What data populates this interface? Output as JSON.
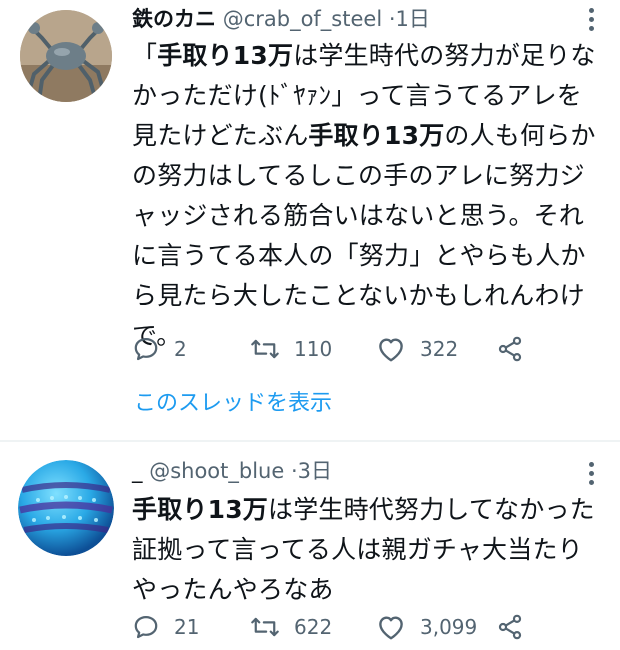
{
  "tweets": [
    {
      "display_name": "鉄のカニ",
      "handle": "@crab_of_steel",
      "separator": "·",
      "time": "1日",
      "body": [
        {
          "text": "「"
        },
        {
          "text": "手取り13万",
          "bold": true
        },
        {
          "text": "は学生時代の努力が足りなかっただけ(ﾄﾞﾔｧﾝ」って言うてるアレを見たけどたぶん"
        },
        {
          "text": "手取り13万",
          "bold": true
        },
        {
          "text": "の人も何らかの努力はしてるしこの手のアレに努力ジャッジされる筋合いはないと思う。それに言うてる本人の「努力」とやらも人から見たら大したことないかもしれんわけで。"
        }
      ],
      "replies": "2",
      "retweets": "110",
      "likes": "322",
      "thread_link": "このスレッドを表示"
    },
    {
      "display_name": "_",
      "handle": "@shoot_blue",
      "separator": "·",
      "time": "3日",
      "body": [
        {
          "text": "手取り13万",
          "bold": true
        },
        {
          "text": "は学生時代努力してなかった証拠って言ってる人は親ガチャ大当たりやったんやろなあ"
        }
      ],
      "replies": "21",
      "retweets": "622",
      "likes": "3,099"
    }
  ],
  "icons": [
    "reply-icon",
    "retweet-icon",
    "like-icon",
    "share-icon",
    "more-icon"
  ],
  "colors": {
    "text": "#0f1419",
    "secondary": "#536471",
    "link": "#1d9bf0",
    "divider": "#eff3f4"
  }
}
